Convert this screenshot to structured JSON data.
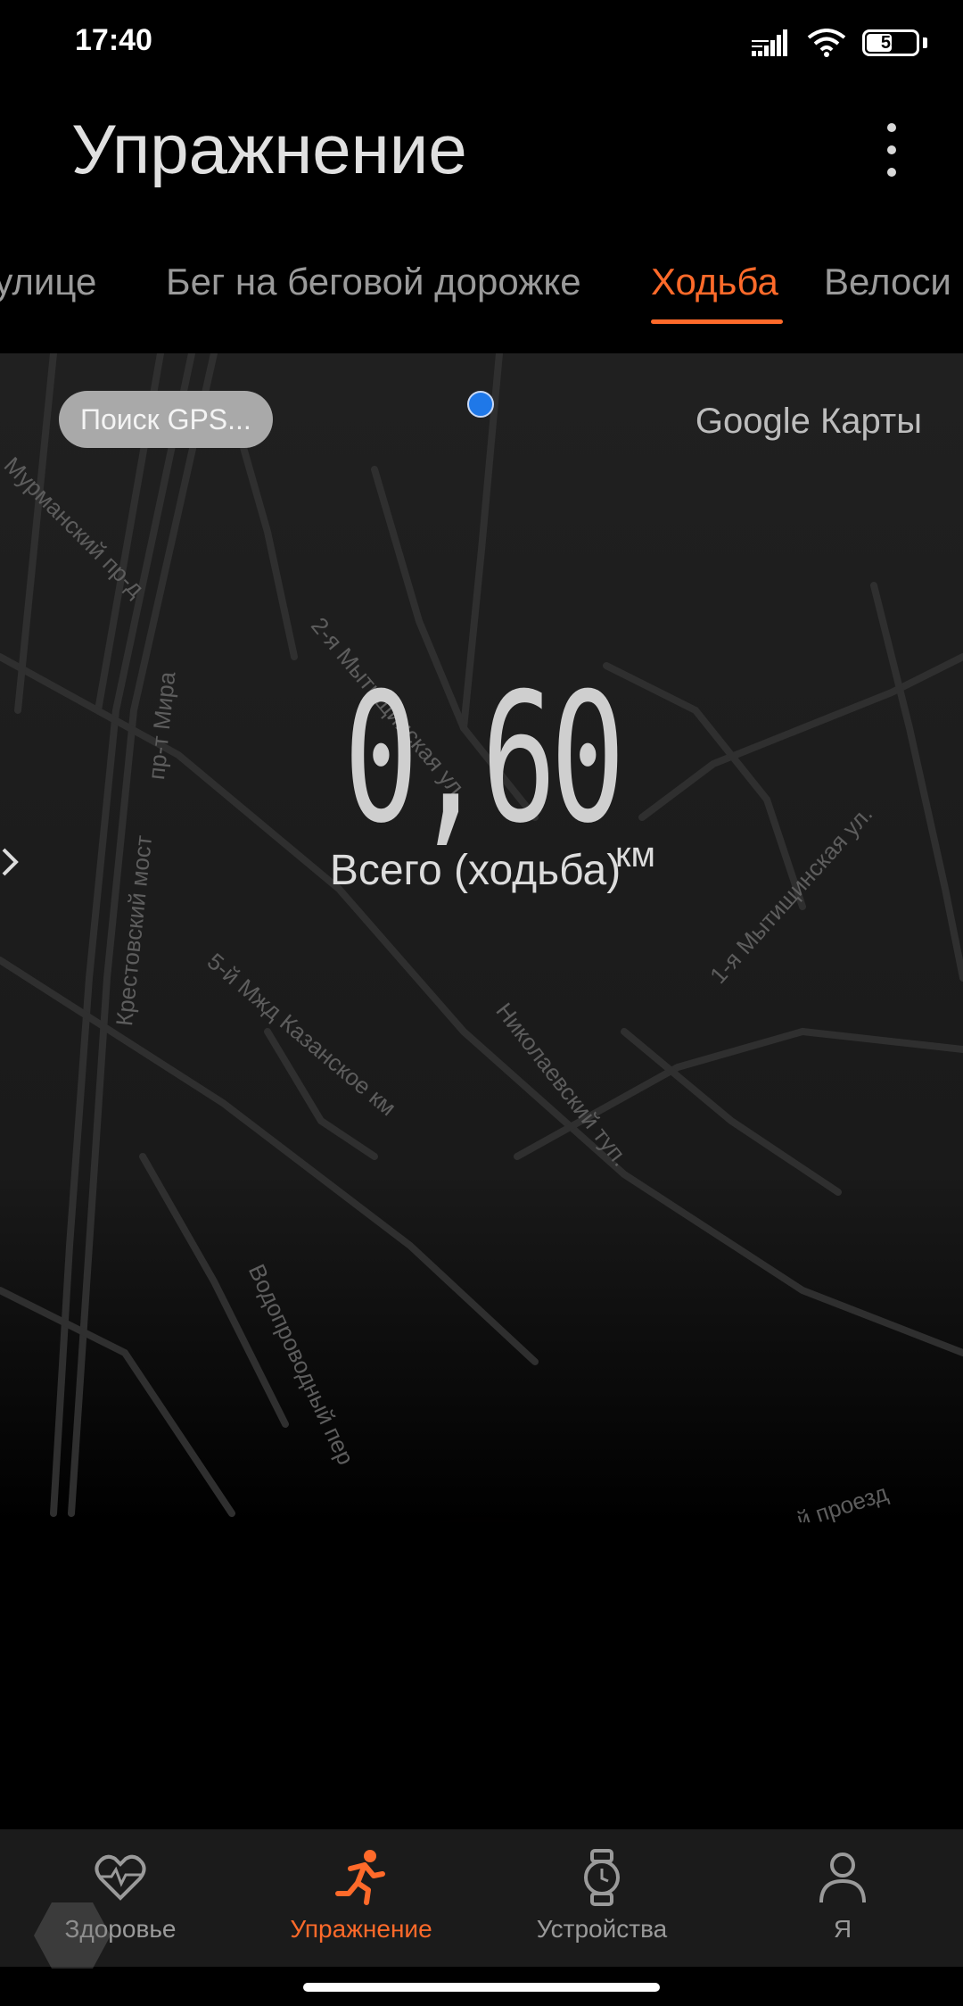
{
  "status_bar": {
    "time": "17:40",
    "battery": "55",
    "battery_level": 0.55
  },
  "header": {
    "title": "Упражнение"
  },
  "tabs": [
    {
      "label": "На улице",
      "visible_text": "улице"
    },
    {
      "label": "Бег на беговой дорожке"
    },
    {
      "label": "Ходьба",
      "active": true
    },
    {
      "label": "Велоси"
    }
  ],
  "map": {
    "gps_status": "Поиск GPS...",
    "provider": "Google Карты",
    "labels": [
      "Мурманский пр-д",
      "2-я Мытищинская ул.",
      "пр-т Мира",
      "Крестовский мост",
      "5-й Мжд Казанское км",
      "Николаевский туп.",
      "1-я Мытищинская ул.",
      "Водопроводный пер",
      "й проезд"
    ]
  },
  "stats": {
    "distance": "0,60",
    "unit": "км",
    "total_label": "Всего (ходьба)"
  },
  "colors": {
    "accent": "#ff6a2a",
    "gps_dot": "#1f78e8"
  },
  "bottom_nav": [
    {
      "label": "Здоровье",
      "icon": "heart-pulse-icon"
    },
    {
      "label": "Упражнение",
      "icon": "running-icon",
      "active": true
    },
    {
      "label": "Устройства",
      "icon": "watch-icon"
    },
    {
      "label": "Я",
      "icon": "person-icon"
    }
  ]
}
